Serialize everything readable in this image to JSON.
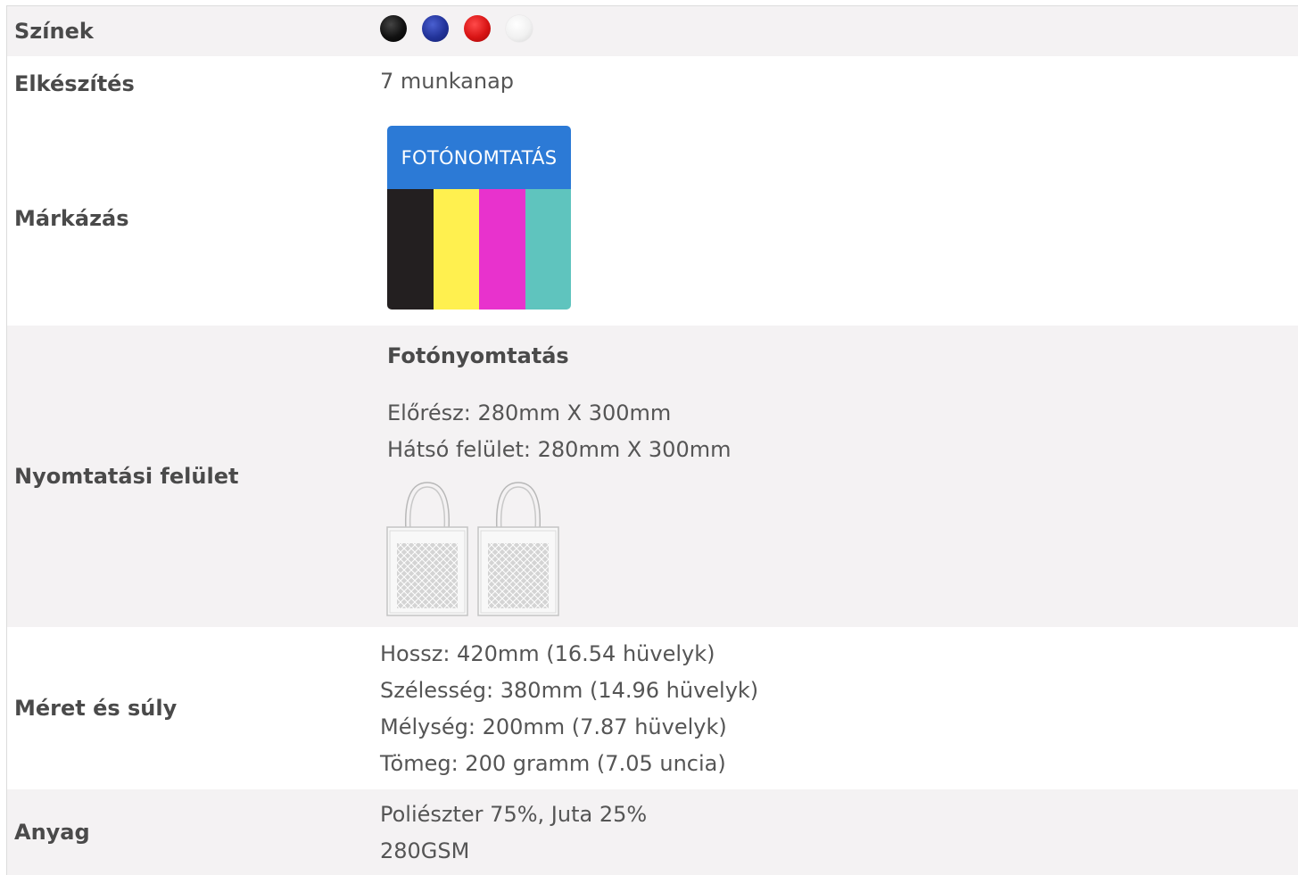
{
  "rows": {
    "colors": {
      "label": "Színek",
      "swatches": [
        "#111111",
        "#223399",
        "#d81414",
        "#f1f1f1"
      ]
    },
    "preparation": {
      "label": "Elkészítés",
      "value": "7 munkanap"
    },
    "branding": {
      "label": "Márkázás",
      "badge_title": "FOTÓNOMTATÁS",
      "badge_colors": [
        "#231f20",
        "#fff04f",
        "#e832cd",
        "#5fc4be"
      ]
    },
    "print_area": {
      "label": "Nyomtatási felület",
      "method": "Fotónyomtatás",
      "areas": [
        "Előrész: 280mm X 300mm",
        "Hátsó felület: 280mm X 300mm"
      ]
    },
    "size_weight": {
      "label": "Méret és súly",
      "lines": [
        "Hossz: 420mm (16.54 hüvelyk)",
        "Szélesség: 380mm (14.96 hüvelyk)",
        "Mélység: 200mm (7.87 hüvelyk)",
        "Tömeg: 200 gramm (7.05 uncia)"
      ]
    },
    "material": {
      "label": "Anyag",
      "lines": [
        "Poliészter 75%, Juta 25%",
        "280GSM"
      ]
    }
  }
}
